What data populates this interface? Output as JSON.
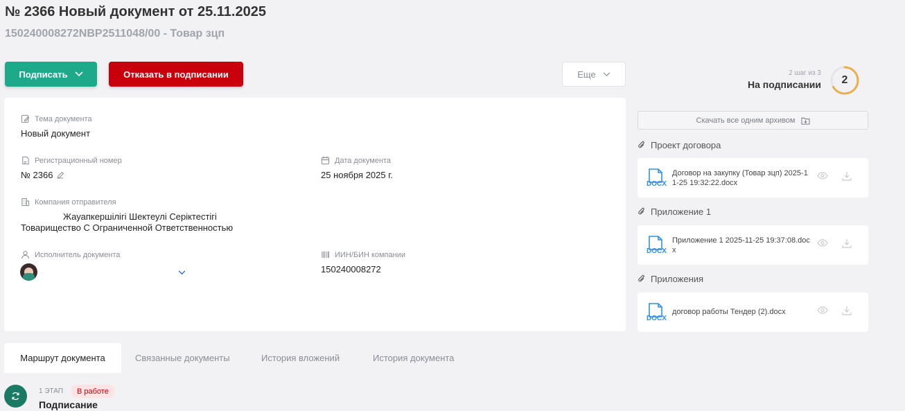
{
  "header": {
    "title": "№ 2366 Новый документ от 25.11.2025",
    "subtitle": "150240008272NBP2511048/00 - Товар зцп"
  },
  "actions": {
    "sign_label": "Подписать",
    "refuse_label": "Отказать в подписании",
    "more_label": "Еще"
  },
  "document": {
    "subject": {
      "label": "Тема документа",
      "value": "Новый документ"
    },
    "reg_number": {
      "label": "Регистрационный номер",
      "value": "№ 2366"
    },
    "doc_date": {
      "label": "Дата документа",
      "value": "25 ноября 2025 г."
    },
    "sender": {
      "label": "Компания отправителя",
      "value_kz": "Жауапкершілігі Шектеулі Серіктестігі",
      "value_ru": "Товарищество С Ограниченной Ответственностью"
    },
    "executor": {
      "label": "Исполнитель документа"
    },
    "bin": {
      "label": "ИИН/БИН компании",
      "value": "150240008272"
    }
  },
  "status": {
    "step_hint": "2 шаг из 3",
    "step_label": "На подписании",
    "step_number": "2",
    "progress_fraction": 0.667
  },
  "attachments": {
    "archive_label": "Скачать все одним архивом",
    "groups": [
      {
        "title": "Проект договора",
        "file_type": "DOCX",
        "file_name": "Договор на закупку (Товар зцп) 2025-11-25 19:32:22.docx"
      },
      {
        "title": "Приложение 1",
        "file_type": "DOCX",
        "file_name": "Приложение 1 2025-11-25 19:37:08.docx"
      },
      {
        "title": "Приложения",
        "file_type": "DOCX",
        "file_name": "договор работы Тендер (2).docx"
      }
    ]
  },
  "tabs": [
    "Маршрут документа",
    "Связанные документы",
    "История вложений",
    "История документа"
  ],
  "stage": {
    "number_label": "1 ЭТАП",
    "badge": "В работе",
    "title": "Подписание"
  },
  "colors": {
    "primary": "#1fa98b",
    "danger": "#c9000b",
    "docx": "#2f8fe6",
    "progress": "#e8b04a"
  }
}
